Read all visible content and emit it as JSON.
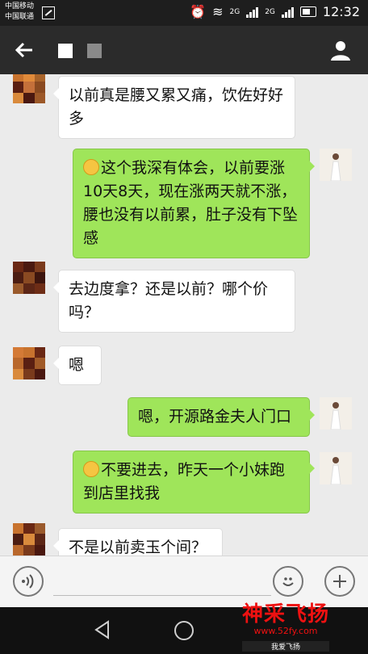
{
  "status_bar": {
    "carrier_1": "中国移动",
    "carrier_2": "中国联通",
    "net_1": "2G",
    "net_2": "2G",
    "time": "12:32"
  },
  "title_bar": {
    "back_icon": "arrow-left-icon",
    "profile_icon": "person-icon"
  },
  "messages": [
    {
      "side": "left",
      "text": "以前真是腰又累又痛，饮佐好好多"
    },
    {
      "side": "right",
      "emoji": "smile-emoji",
      "text": "这个我深有体会，以前要涨10天8天，现在涨两天就不涨，腰也没有以前累，肚子没有下坠感"
    },
    {
      "side": "left",
      "text": "去边度拿？还是以前？哪个价吗？"
    },
    {
      "side": "left",
      "text": "嗯"
    },
    {
      "side": "right",
      "text": "嗯，开源路金夫人门口"
    },
    {
      "side": "right",
      "emoji": "smile-emoji",
      "text": "不要进去，昨天一个小妹跑到店里找我"
    },
    {
      "side": "left",
      "text": "不是以前卖玉个间？"
    }
  ],
  "input_bar": {
    "voice_icon": "voice-icon",
    "emoji_icon": "smiley-icon",
    "plus_icon": "plus-icon"
  },
  "watermark": {
    "title": "神采飞扬",
    "url": "www.52fy.com",
    "sub": "我爱飞扬"
  },
  "colors": {
    "bubble_green": "#9fe55a",
    "titlebar": "#2b2b2b",
    "chat_bg": "#ebebeb"
  }
}
